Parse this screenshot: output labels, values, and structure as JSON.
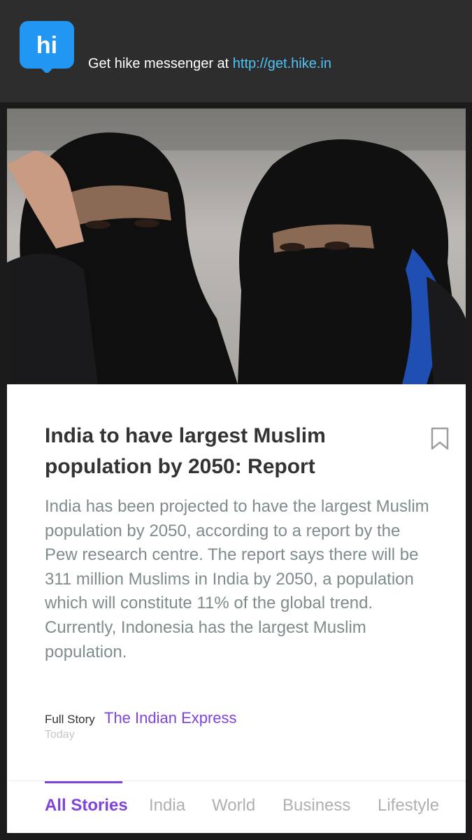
{
  "promo": {
    "text": "Get hike messenger at ",
    "link": "http://get.hike.in",
    "logo_text": "hi"
  },
  "article": {
    "title": "India to have largest Muslim population by 2050: Report",
    "summary": "India has been projected to have the largest Muslim population by 2050, according to a report by the Pew research centre. The report says there will be 311 million Muslims in India by 2050, a population which will constitute 11% of the global trend. Currently, Indonesia has the largest Muslim population.",
    "full_story_label": "Full Story",
    "source": "The Indian Express",
    "date": "Today"
  },
  "tabs": [
    {
      "label": "All Stories",
      "active": true
    },
    {
      "label": "India",
      "active": false
    },
    {
      "label": "World",
      "active": false
    },
    {
      "label": "Business",
      "active": false
    },
    {
      "label": "Lifestyle",
      "active": false
    }
  ],
  "colors": {
    "accent": "#7e44d9",
    "link": "#4fc3f7",
    "logo_blue": "#2196f3",
    "top_bar": "#2d2d2d"
  }
}
